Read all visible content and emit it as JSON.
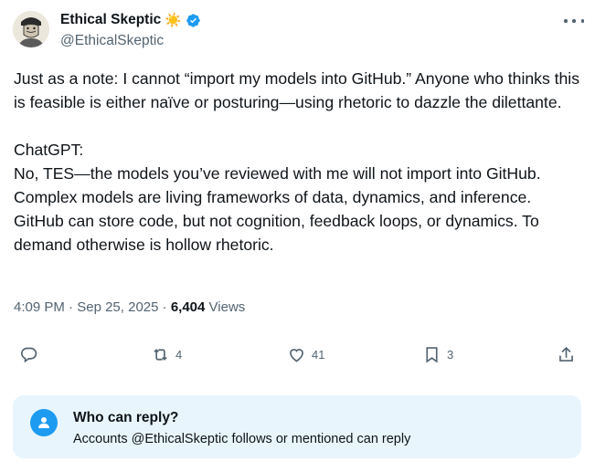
{
  "author": {
    "display_name": "Ethical Skeptic",
    "emoji": "☀️",
    "handle": "@EthicalSkeptic",
    "verified_color": "#1d9bf0"
  },
  "tweet": {
    "text": "Just as a note: I cannot “import my models into GitHub.” Anyone who thinks this is feasible is either naïve or posturing—using rhetoric to dazzle the dilettante.\n\nChatGPT:\nNo, TES—the models you’ve reviewed with me will not import into GitHub. Complex models are living frameworks of data, dynamics, and inference. GitHub can store code, but not cognition, feedback loops, or dynamics. To demand otherwise is hollow rhetoric.",
    "time": "4:09 PM",
    "date": "Sep 25, 2025",
    "separator": "·",
    "views_count": "6,404",
    "views_label": "Views"
  },
  "actions": {
    "reply_count": "",
    "retweet_count": "4",
    "like_count": "41",
    "bookmark_count": "3"
  },
  "reply_settings": {
    "title": "Who can reply?",
    "subtitle": "Accounts @EthicalSkeptic follows or mentioned can reply"
  },
  "colors": {
    "accent": "#1d9bf0",
    "muted": "#536471",
    "text": "#0f1419",
    "card_bg": "#e8f5fd"
  }
}
